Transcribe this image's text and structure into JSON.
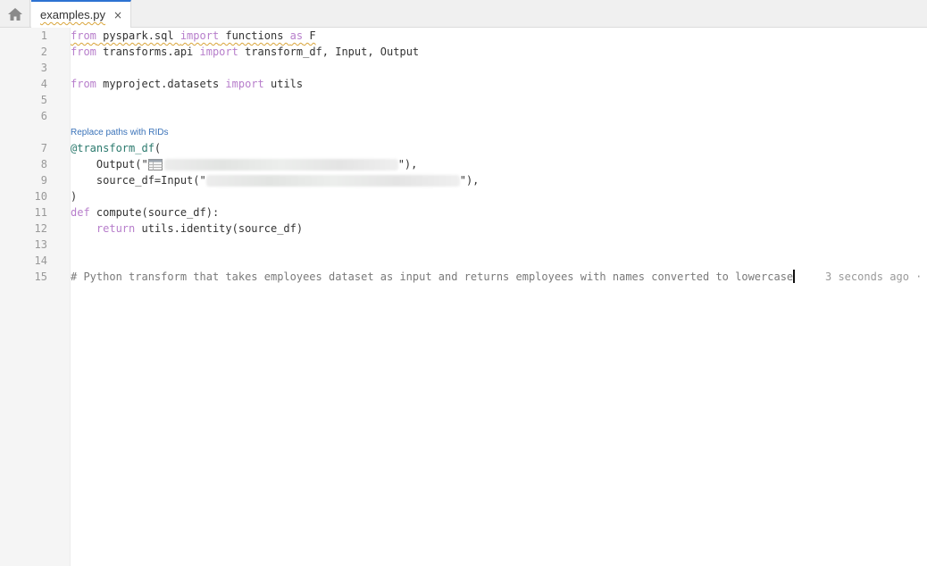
{
  "tabs": [
    {
      "label": "examples.py",
      "close_glyph": "×",
      "active": true
    }
  ],
  "icons": {
    "home": "home-icon",
    "close": "close-icon",
    "dataset": "dataset-table-icon"
  },
  "editor": {
    "line_numbers": [
      "1",
      "2",
      "3",
      "4",
      "5",
      "6",
      "7",
      "8",
      "9",
      "10",
      "11",
      "12",
      "13",
      "14",
      "15"
    ],
    "codelens": "Replace paths with RIDs",
    "lines": {
      "l1": {
        "kw1": "from",
        "mod": " pyspark.sql ",
        "kw2": "import",
        "name": " functions ",
        "kw3": "as",
        "alias": " F"
      },
      "l2": {
        "kw1": "from",
        "mod": " transforms.api ",
        "kw2": "import",
        "names": " transform_df, Input, Output"
      },
      "l4": {
        "kw1": "from",
        "mod": " myproject.datasets ",
        "kw2": "import",
        "names": " utils"
      },
      "l7": {
        "decorator": "@transform_df",
        "rest": "("
      },
      "l8": {
        "indent": "    ",
        "prefix": "Output(\"",
        "suffix": "\"),"
      },
      "l9": {
        "indent": "    ",
        "prefix": "source_df=Input(\"",
        "suffix": "\"),"
      },
      "l10": {
        "text": ")"
      },
      "l11": {
        "kw": "def",
        "rest": " compute(source_df):"
      },
      "l12": {
        "indent": "    ",
        "kw": "return",
        "rest": " utils.identity(source_df)"
      },
      "l15": {
        "comment": "# Python transform that takes employees dataset as input and returns employees with names converted to lowercase"
      }
    },
    "ghost_text": "3 seconds ago ·"
  },
  "colors": {
    "keyword": "#b77ecb",
    "decorator": "#2c7a6e",
    "comment": "#7a7a7a",
    "link": "#3b73b9",
    "accent": "#2d72d2",
    "warning_squiggle": "#d9a53b"
  }
}
